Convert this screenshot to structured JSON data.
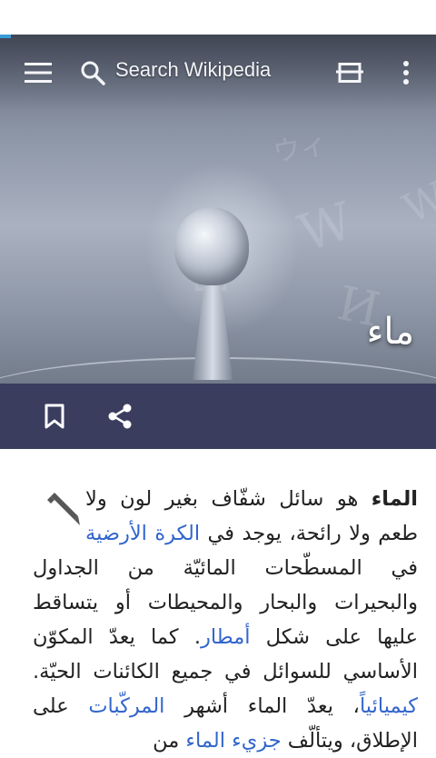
{
  "toolbar": {
    "search_placeholder": "Search Wikipedia",
    "menu_icon": "menu-icon",
    "search_icon": "search-icon",
    "tabs_icon": "tabs-icon",
    "overflow_icon": "more-vert-icon"
  },
  "article": {
    "title": "ماء",
    "actions": {
      "bookmark_icon": "bookmark-icon",
      "share_icon": "share-icon"
    },
    "edit_icon": "pencil-icon",
    "lead": {
      "bold_term": "الماء",
      "t1": " هو سائل شفّاف بغير لون ولا طعم ولا رائحة، يوجد في ",
      "link1": "الكرة الأرضية",
      "t2": " في المسطّحات المائيّة من الجداول والبحيرات والبحار والمحيطات أو يتساقط عليها على شكل ",
      "link2": "أمطار",
      "t3": ". كما يعدّ المكوّن الأساسي للسوائل في جميع الكائنات الحيّة. ",
      "link3": "كيميائياً",
      "t4": "، يعدّ الماء أشهر ",
      "link4": "المركّبات",
      "t5": " على الإطلاق، ويتألّف ",
      "link5": "جزيء الماء",
      "t6": " من"
    }
  },
  "colors": {
    "action_bar": "#3b3d5f",
    "link": "#3366cc",
    "accent_strip": "#3a9bd9"
  }
}
